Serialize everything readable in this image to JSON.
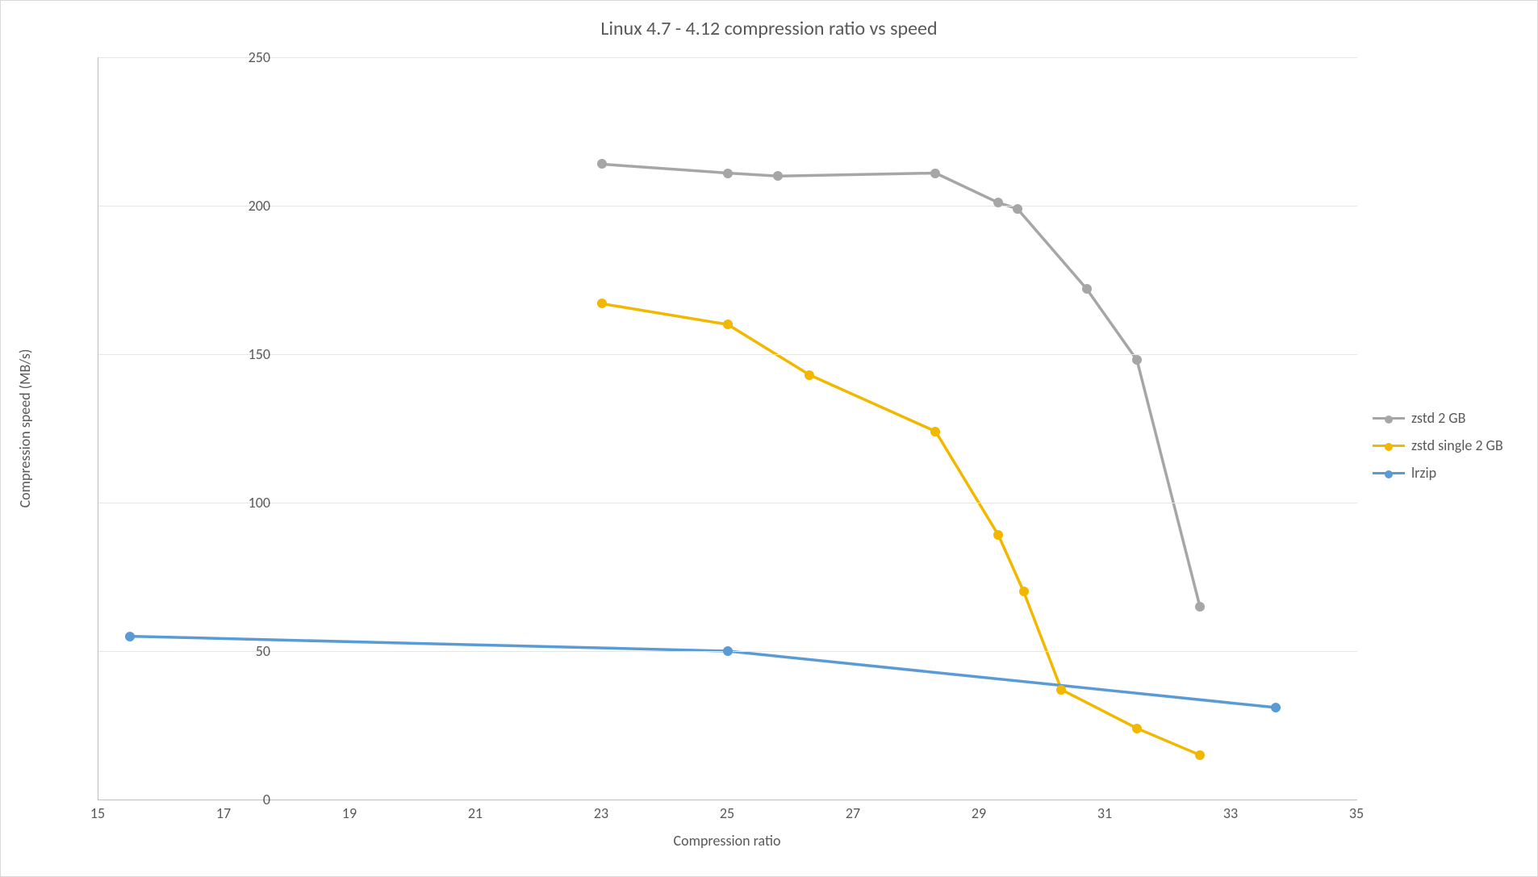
{
  "chart_data": {
    "type": "line",
    "title": "Linux 4.7 - 4.12 compression ratio vs speed",
    "xlabel": "Compression ratio",
    "ylabel": "Compression speed (MB/s)",
    "xlim": [
      15,
      35
    ],
    "ylim": [
      0,
      250
    ],
    "xticks": [
      15,
      17,
      19,
      21,
      23,
      25,
      27,
      29,
      31,
      33,
      35
    ],
    "yticks": [
      0,
      50,
      100,
      150,
      200,
      250
    ],
    "grid": "horizontal",
    "legend_position": "right",
    "series": [
      {
        "name": "zstd 2 GB",
        "color": "#a6a6a6",
        "x": [
          23.0,
          25.0,
          25.8,
          28.3,
          29.3,
          29.6,
          30.7,
          31.5,
          32.5
        ],
        "y": [
          214,
          211,
          210,
          211,
          201,
          199,
          172,
          148,
          65
        ]
      },
      {
        "name": "zstd single 2 GB",
        "color": "#f2b800",
        "x": [
          23.0,
          25.0,
          26.3,
          28.3,
          29.3,
          29.7,
          30.3,
          31.5,
          32.5
        ],
        "y": [
          167,
          160,
          143,
          124,
          89,
          70,
          37,
          24,
          15
        ]
      },
      {
        "name": "lrzip",
        "color": "#5b9bd5",
        "x": [
          15.5,
          25.0,
          33.7
        ],
        "y": [
          55,
          50,
          31
        ]
      }
    ]
  }
}
